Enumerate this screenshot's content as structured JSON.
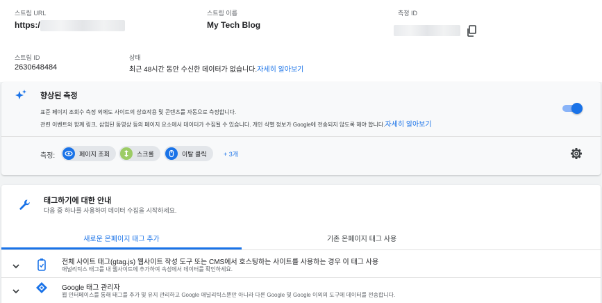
{
  "stream": {
    "url_label": "스트림 URL",
    "url_value": "https:/",
    "name_label": "스트림 이름",
    "name_value": "My Tech Blog",
    "measurement_id_label": "측정 ID",
    "stream_id_label": "스트림 ID",
    "stream_id_value": "2630648484",
    "status_label": "상태",
    "status_text": "최근 48시간 동안 수신한 데이터가 없습니다.",
    "status_link": "자세히 알아보기"
  },
  "enhanced": {
    "title": "향상된 측정",
    "desc_line1": "표준 페이지 조회수 측정 외에도 사이트의 상호작용 및 콘텐츠를 자동으로 측정합니다.",
    "desc_line2": "관련 이벤트와 함께 링크, 삽입된 동영상 등의 페이지 요소에서 데이터가 수집될 수 있습니다. 개인 식별 정보가 Google에 전송되지 않도록 해야 합니다.",
    "desc_link": "자세히 알아보기",
    "toggle_on": true,
    "measure_label": "측정:",
    "chips": [
      {
        "label": "페이지 조회",
        "icon": "eye-icon",
        "color": "#1a73e8"
      },
      {
        "label": "스크롤",
        "icon": "scroll-icon",
        "color": "#9ccc65"
      },
      {
        "label": "이탈 클릭",
        "icon": "mouse-icon",
        "color": "#1a73e8"
      }
    ],
    "more": "+ 3개"
  },
  "tagging": {
    "title": "태그하기에 대한 안내",
    "subtitle": "다음 중 하나를 사용하여 데이터 수집을 시작하세요.",
    "tabs": [
      {
        "label": "새로운 온페이지 태그 추가",
        "active": true
      },
      {
        "label": "기존 온페이지 태그 사용",
        "active": false
      }
    ],
    "rows": [
      {
        "title": "전체 사이트 태그(gtag.js) 웹사이트 작성 도구 또는 CMS에서 호스팅하는 사이트를 사용하는 경우 이 태그 사용",
        "subtitle": "애널리틱스 태그를 내 웹사이트에 추가하여 속성에서 데이터를 확인하세요.",
        "icon": "gtag-icon"
      },
      {
        "title": "Google 태그 관리자",
        "subtitle": "웹 인터페이스를 통해 태그를 추가 및 유지 관리하고 Google 애널리틱스뿐만 아니라 다른 Google 및 Google 이외의 도구에 데이터를 전송합니다.",
        "icon": "tag-manager-icon"
      }
    ]
  },
  "colors": {
    "accent": "#1a73e8",
    "toggle_track": "#8ab4f8"
  }
}
